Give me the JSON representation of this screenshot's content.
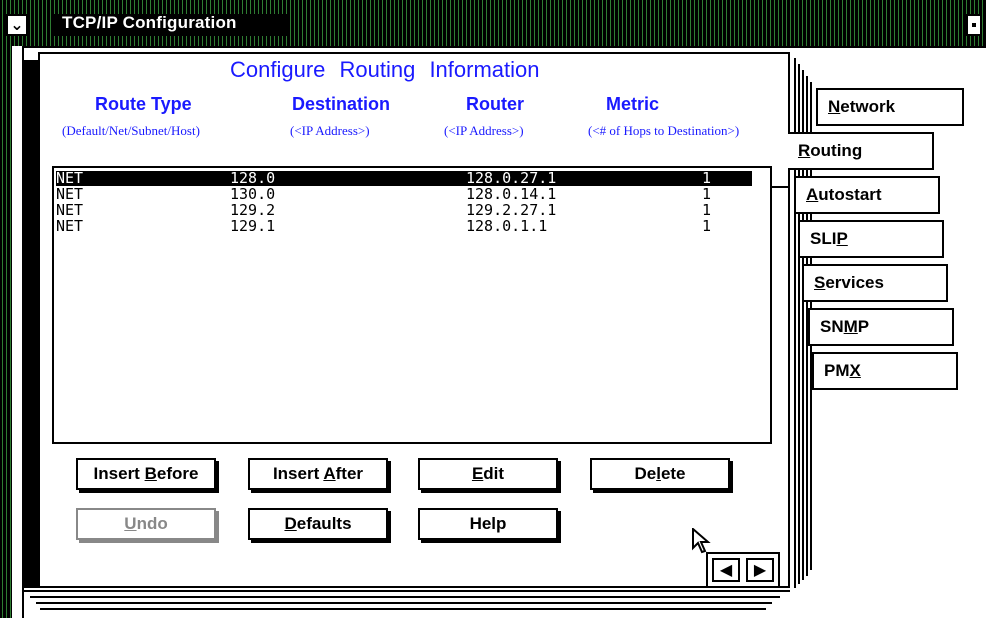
{
  "window": {
    "title": "TCP/IP Configuration"
  },
  "page": {
    "heading": "Configure Routing Information",
    "columns": [
      {
        "label": "Route Type",
        "sub": "(Default/Net/Subnet/Host)"
      },
      {
        "label": "Destination",
        "sub": "(<IP Address>)"
      },
      {
        "label": "Router",
        "sub": "(<IP Address>)"
      },
      {
        "label": "Metric",
        "sub": "(<# of Hops to Destination>)"
      }
    ],
    "routes": [
      {
        "type": "NET",
        "destination": "128.0",
        "router": "128.0.27.1",
        "metric": "1",
        "selected": true
      },
      {
        "type": "NET",
        "destination": "130.0",
        "router": "128.0.14.1",
        "metric": "1",
        "selected": false
      },
      {
        "type": "NET",
        "destination": "129.2",
        "router": "129.2.27.1",
        "metric": "1",
        "selected": false
      },
      {
        "type": "NET",
        "destination": "129.1",
        "router": "128.0.1.1",
        "metric": "1",
        "selected": false
      }
    ]
  },
  "buttons": {
    "insert_before": {
      "pre": "Insert ",
      "key": "B",
      "post": "efore"
    },
    "insert_after": {
      "pre": "Insert ",
      "key": "A",
      "post": "fter"
    },
    "edit": {
      "pre": "",
      "key": "E",
      "post": "dit"
    },
    "delete": {
      "pre": "De",
      "key": "l",
      "post": "ete"
    },
    "undo": {
      "pre": "",
      "key": "U",
      "post": "ndo"
    },
    "defaults": {
      "pre": "",
      "key": "D",
      "post": "efaults"
    },
    "help": {
      "pre": "Help",
      "key": "",
      "post": ""
    }
  },
  "tabs": [
    {
      "pre": "",
      "key": "N",
      "post": "etwork"
    },
    {
      "pre": "",
      "key": "R",
      "post": "outing"
    },
    {
      "pre": "",
      "key": "A",
      "post": "utostart"
    },
    {
      "pre": "SLI",
      "key": "P",
      "post": ""
    },
    {
      "pre": "",
      "key": "S",
      "post": "ervices"
    },
    {
      "pre": "SN",
      "key": "M",
      "post": "P"
    },
    {
      "pre": "PM",
      "key": "X",
      "post": ""
    }
  ],
  "nav": {
    "prev_icon": "arrow-left-icon",
    "next_icon": "arrow-right-icon"
  },
  "icons": {
    "system_menu": "minimize-arrow-icon",
    "restore": "restore-icon",
    "cursor": "mouse-pointer-icon"
  },
  "colors": {
    "heading_blue": "#1a1aff",
    "titlebar": "#000000"
  }
}
